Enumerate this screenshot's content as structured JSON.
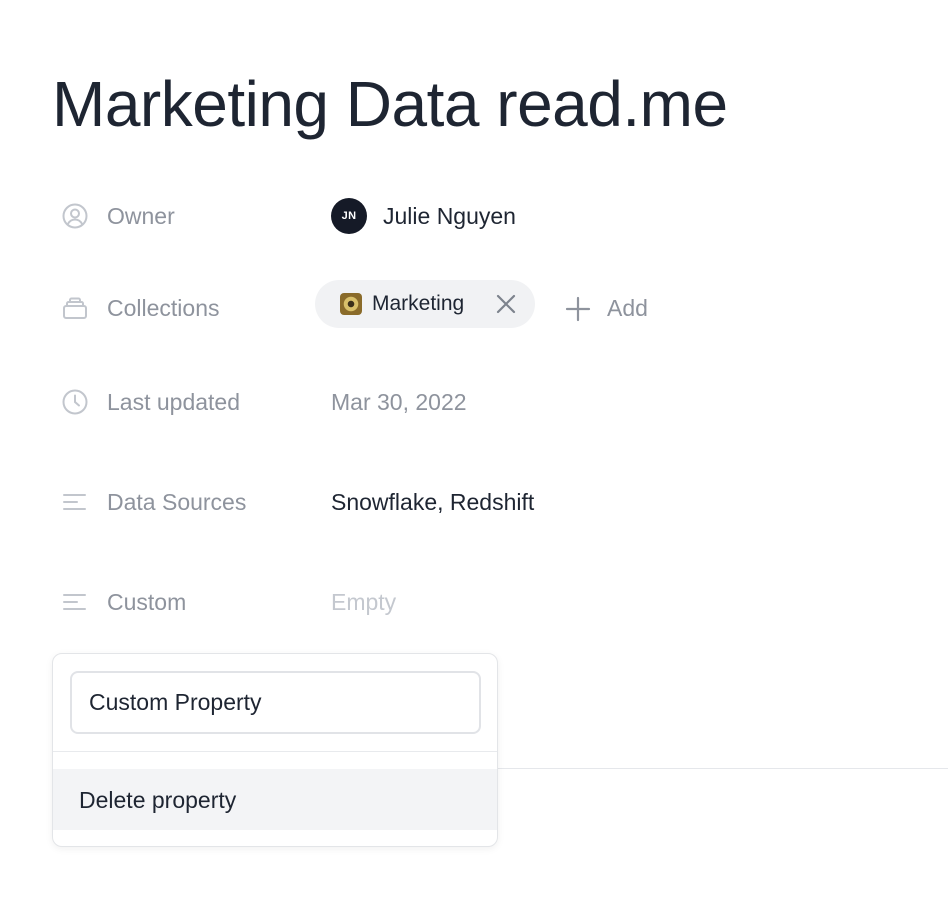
{
  "page": {
    "title": "Marketing Data read.me"
  },
  "properties": {
    "owner": {
      "label": "Owner",
      "icon": "user-circle-icon",
      "avatar_initials": "JN",
      "name": "Julie Nguyen"
    },
    "collections": {
      "label": "Collections",
      "icon": "collection-icon",
      "chip_label": "Marketing",
      "chip_icon": "disc-emoji-icon",
      "add_label": "Add"
    },
    "last_updated": {
      "label": "Last updated",
      "icon": "clock-icon",
      "value": "Mar 30, 2022"
    },
    "data_sources": {
      "label": "Data Sources",
      "icon": "text-lines-icon",
      "value": "Snowflake, Redshift"
    },
    "custom": {
      "label": "Custom",
      "icon": "text-lines-icon",
      "value": "Empty"
    }
  },
  "popover": {
    "input_value": "Custom Property",
    "delete_label": "Delete property"
  },
  "colors": {
    "title": "#1e2532",
    "label": "#8e939d",
    "placeholder": "#c4c8cf",
    "avatar_bg": "#151a27",
    "chip_bg": "#f1f2f4",
    "menu_hover": "#f3f4f6"
  }
}
